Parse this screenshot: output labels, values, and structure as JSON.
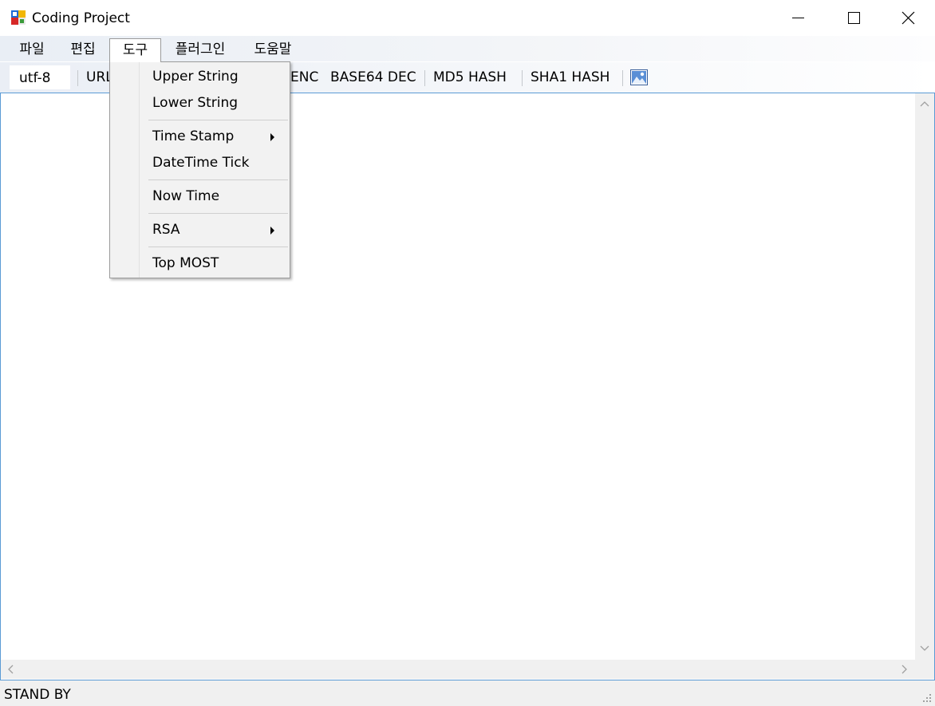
{
  "window": {
    "title": "Coding Project",
    "controls": {
      "minimize": "minimize-icon",
      "maximize": "maximize-icon",
      "close": "close-icon"
    }
  },
  "menubar": {
    "items": [
      {
        "label": "파일"
      },
      {
        "label": "편집"
      },
      {
        "label": "도구",
        "open": true
      },
      {
        "label": "플러그인"
      },
      {
        "label": "도움말"
      }
    ]
  },
  "toolbar": {
    "encoding": "utf-8",
    "buttons": [
      {
        "label": "URL"
      },
      {
        "label": "ENC"
      },
      {
        "label": "BASE64 DEC"
      },
      {
        "label": "MD5 HASH"
      },
      {
        "label": "SHA1 HASH"
      }
    ],
    "image_button_icon": "picture-icon"
  },
  "tools_menu": {
    "items": [
      {
        "label": "Upper String"
      },
      {
        "label": "Lower String"
      },
      {
        "label": "Time Stamp",
        "submenu": true
      },
      {
        "label": "DateTime Tick"
      },
      {
        "label": "Now Time"
      },
      {
        "label": "RSA",
        "submenu": true
      },
      {
        "label": "Top MOST"
      }
    ]
  },
  "editor": {
    "value": ""
  },
  "statusbar": {
    "text": "STAND BY"
  },
  "colors": {
    "editor_border": "#5b9bd5",
    "menu_background": "#f2f2f2",
    "status_background": "#f0f0f0"
  }
}
